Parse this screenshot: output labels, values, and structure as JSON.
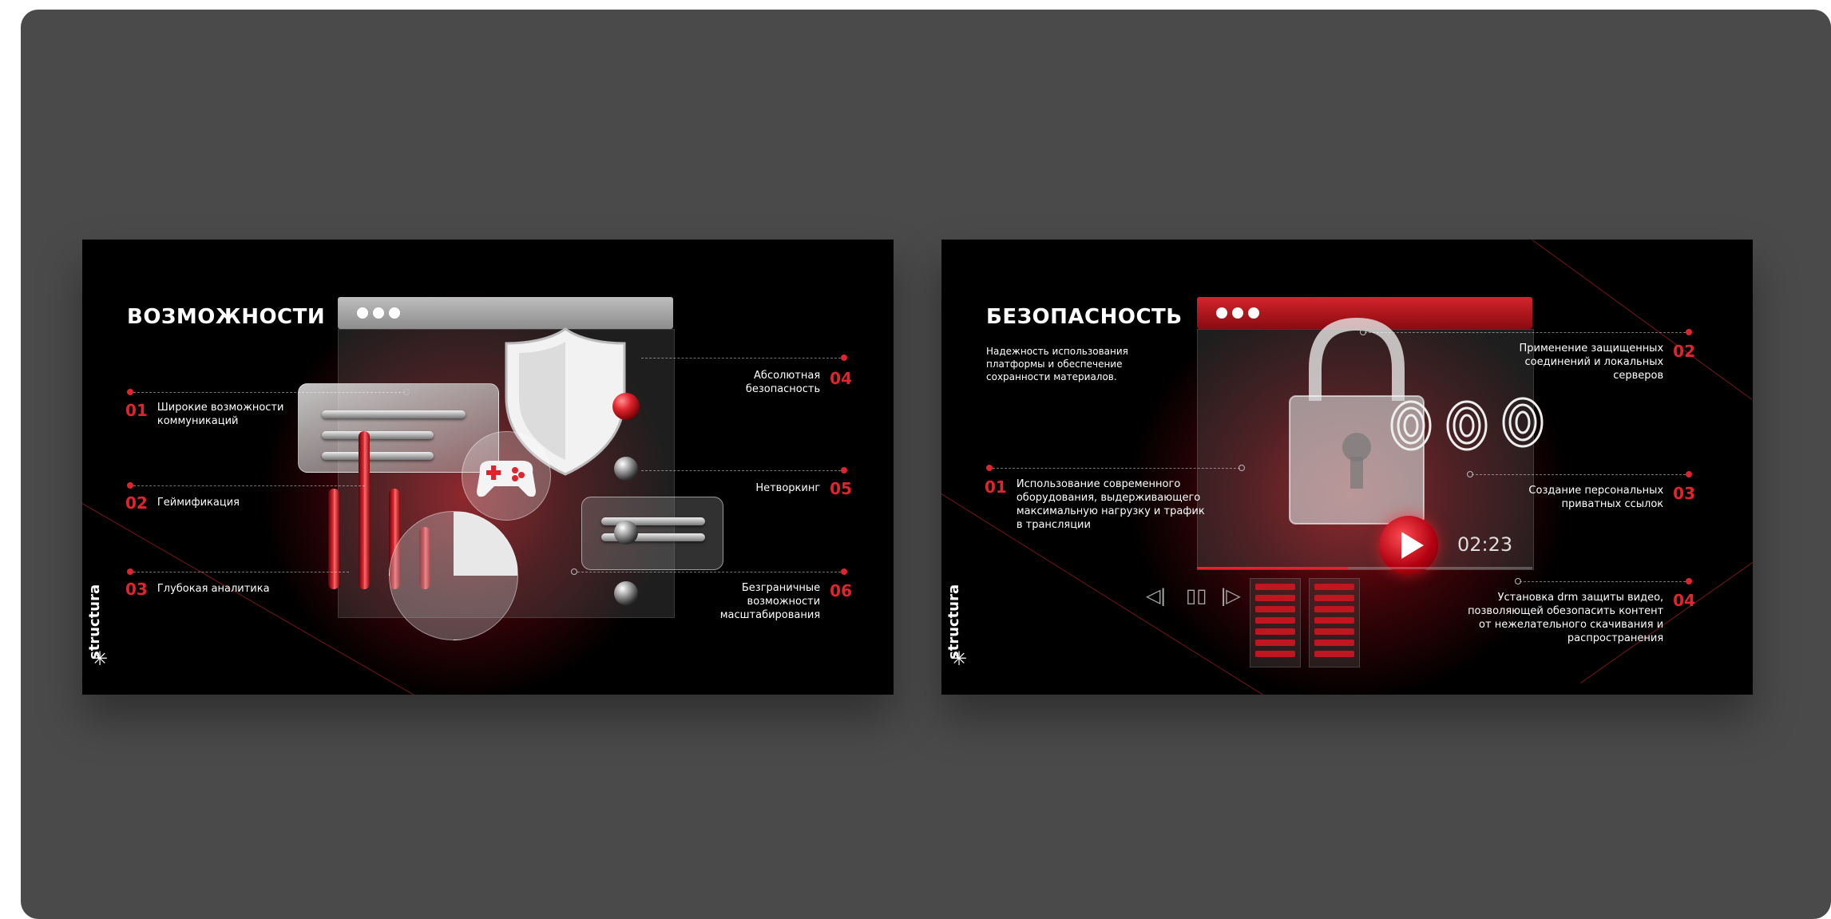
{
  "brand": {
    "name": "structura",
    "star": "✳"
  },
  "slide_left": {
    "title": "ВОЗМОЖНОСТИ",
    "items": [
      {
        "num": "01",
        "label": "Широкие возможности коммуникаций"
      },
      {
        "num": "02",
        "label": "Геймификация"
      },
      {
        "num": "03",
        "label": "Глубокая аналитика"
      },
      {
        "num": "04",
        "label": "Абсолютная безопасность"
      },
      {
        "num": "05",
        "label": "Нетворкинг"
      },
      {
        "num": "06",
        "label": "Безграничные возможности масштабирования"
      }
    ]
  },
  "slide_right": {
    "title": "БЕЗОПАСНОСТЬ",
    "intro": "Надежность использования платформы и обеспечение сохранности материалов.",
    "time": "02:23",
    "items": [
      {
        "num": "01",
        "label": "Использование современного оборудования, выдерживающего максимальную нагрузку и трафик в трансляции"
      },
      {
        "num": "02",
        "label": "Применение защищенных соединений и локальных серверов"
      },
      {
        "num": "03",
        "label": "Создание персональных приватных ссылок"
      },
      {
        "num": "04",
        "label": "Установка drm защиты видео, позволяющей обезопасить контент от нежелательного скачивания и распространения"
      }
    ]
  },
  "colors": {
    "accent": "#e0242e",
    "background": "#4a4a4a",
    "slide": "#000000"
  }
}
